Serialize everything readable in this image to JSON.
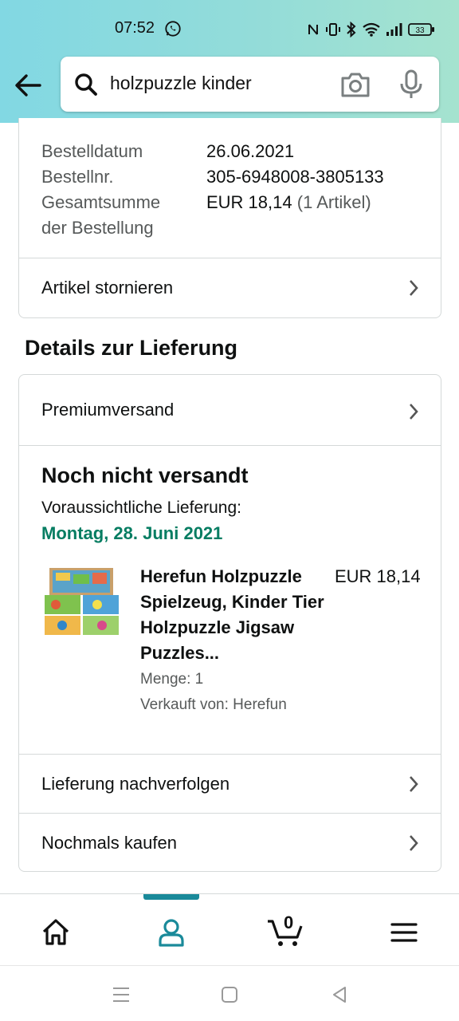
{
  "status_bar": {
    "time": "07:52",
    "battery": "33"
  },
  "search": {
    "query": "holzpuzzle kinder"
  },
  "order_summary": {
    "order_date_label": "Bestelldatum",
    "order_date_value": "26.06.2021",
    "order_number_label": "Bestellnr.",
    "order_number_value": "305-6948008-3805133",
    "total_label_line1": "Gesamtsumme",
    "total_label_line2": "der Bestellung",
    "total_value": "EUR 18,14",
    "total_items": "(1 Artikel)",
    "cancel_label": "Artikel stornieren"
  },
  "delivery": {
    "section_title": "Details zur Lieferung",
    "shipping_method": "Premiumversand",
    "ship_status": "Noch nicht versandt",
    "expected_label": "Voraussichtliche Lieferung:",
    "expected_date": "Montag, 28. Juni 2021",
    "product": {
      "title": "Herefun Holzpuzzle Spielzeug, Kinder Tier Holzpuzzle Jigsaw Puzzles...",
      "price": "EUR 18,14",
      "quantity": "Menge: 1",
      "seller": "Verkauft von: Herefun"
    },
    "track_label": "Lieferung nachverfolgen",
    "buy_again_label": "Nochmals kaufen"
  },
  "bottom_nav": {
    "cart_count": "0",
    "active_tab": "account",
    "accent_color": "#1a8a9a"
  },
  "colors": {
    "header_gradient_start": "#82d8e3",
    "header_gradient_end": "#a5e3cf",
    "delivery_date_green": "#067d62"
  }
}
